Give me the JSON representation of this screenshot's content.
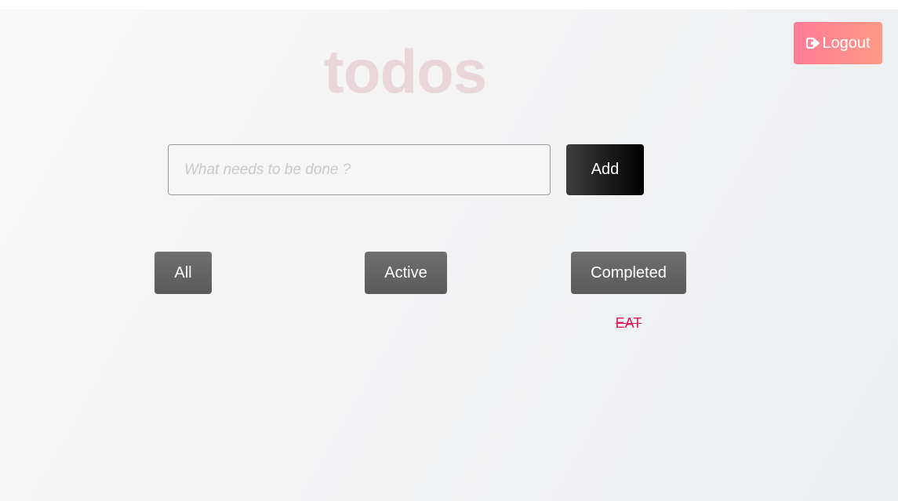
{
  "header": {
    "title": "todos",
    "logout_label": "Logout"
  },
  "new_todo": {
    "placeholder": "What needs to be done ?",
    "value": "",
    "add_label": "Add"
  },
  "filters": [
    {
      "label": "All"
    },
    {
      "label": "Active"
    },
    {
      "label": "Completed"
    }
  ],
  "todos": [
    {
      "text": "EAT",
      "completed": true
    }
  ],
  "colors": {
    "title": "#ead6d9",
    "logout_gradient_start": "#ff7a96",
    "logout_gradient_end": "#ff9a86",
    "completed_todo": "#e0195a",
    "filter_button": "#666666",
    "add_button": "#000000"
  },
  "icons": {
    "logout": "sign-out-icon"
  }
}
